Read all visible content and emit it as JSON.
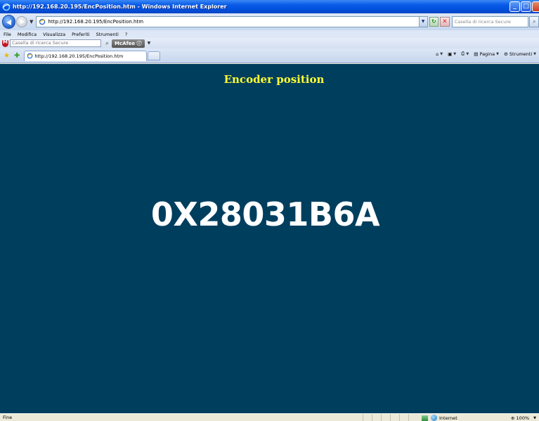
{
  "window": {
    "title": "http://192.168.20.195/EncPosition.htm - Windows Internet Explorer"
  },
  "address_bar": {
    "url": "http://192.168.20.195/EncPosition.htm",
    "search_placeholder": "Casella di ricerca Secure"
  },
  "menu": {
    "items": [
      "File",
      "Modifica",
      "Visualizza",
      "Preferiti",
      "Strumenti",
      "?"
    ]
  },
  "mcafee_toolbar": {
    "search_placeholder": "Casella di ricerca Secure",
    "brand_label": "McAfee"
  },
  "tab_bar": {
    "active_tab_label": "http://192.168.20.195/EncPosition.htm",
    "page_menu_label": "Pagina",
    "tools_menu_label": "Strumenti"
  },
  "page": {
    "heading": "Encoder position",
    "encoder_value": "0X28031B6A",
    "background_color": "#003e5e",
    "heading_color": "#ffff33"
  },
  "status_bar": {
    "status_text": "Fine",
    "zone_label": "Internet",
    "zoom_label": "100%"
  }
}
